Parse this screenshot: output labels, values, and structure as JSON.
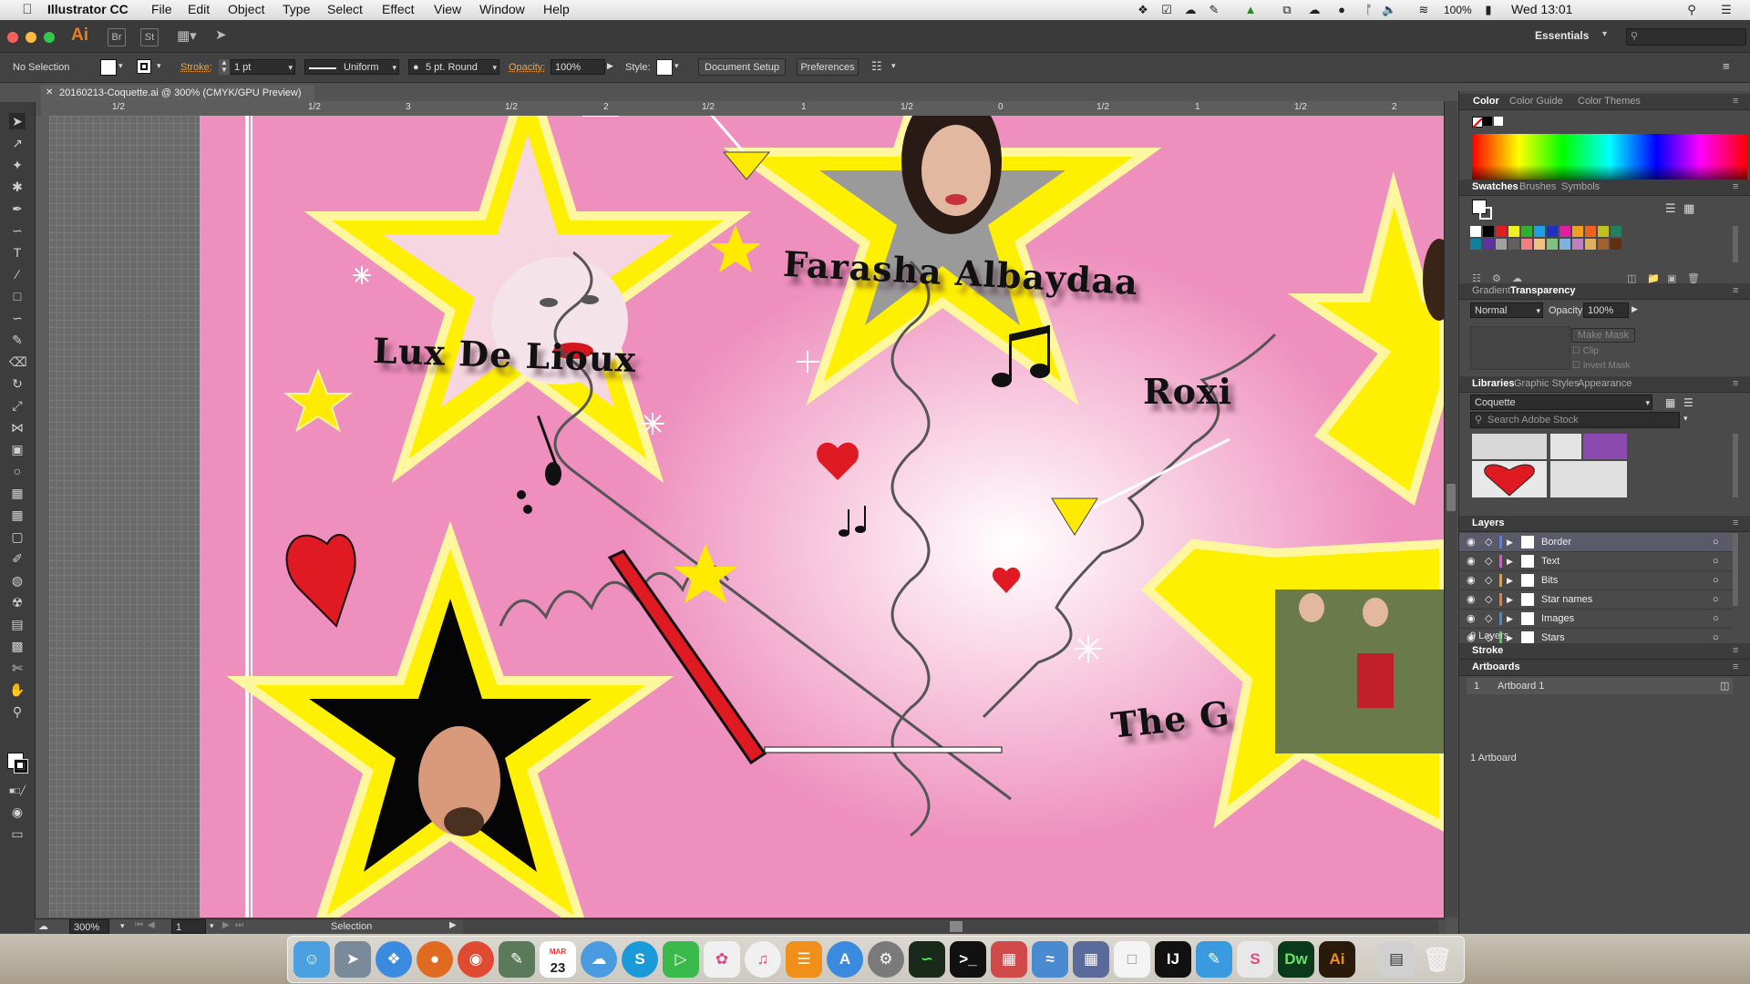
{
  "menubar": {
    "app_name": "Illustrator CC",
    "menus": [
      "File",
      "Edit",
      "Object",
      "Type",
      "Select",
      "Effect",
      "View",
      "Window",
      "Help"
    ],
    "battery": "100%",
    "clock": "Wed 13:01"
  },
  "appbar": {
    "logo": "Ai",
    "bridge": "Br",
    "stock": "St",
    "workspace": "Essentials"
  },
  "controlbar": {
    "selection": "No Selection",
    "stroke_label": "Stroke:",
    "stroke_value": "1 pt",
    "profile": "Uniform",
    "brush": "5 pt. Round",
    "opacity_label": "Opacity:",
    "opacity_value": "100%",
    "style_label": "Style:",
    "document_setup": "Document Setup",
    "preferences": "Preferences"
  },
  "document": {
    "tab_title": "20160213-Coquette.ai @ 300% (CMYK/GPU Preview)",
    "ruler_labels": [
      "1/2",
      "1/2",
      "3",
      "1/2",
      "2",
      "1/2",
      "1",
      "1/2",
      "0",
      "1/2",
      "1",
      "1/2",
      "2"
    ]
  },
  "artwork": {
    "performers": [
      "Lux De Lioux",
      "Farasha Albaydaa",
      "Roxi",
      "The G"
    ]
  },
  "status": {
    "zoom": "300%",
    "artboard_number": "1",
    "tool": "Selection"
  },
  "panels": {
    "color_tabs": [
      "Color",
      "Color Guide",
      "Color Themes"
    ],
    "swatch_tabs": [
      "Swatches",
      "Brushes",
      "Symbols"
    ],
    "gradient_tabs": [
      "Gradient",
      "Transparency"
    ],
    "blend_mode": "Normal",
    "opacity_label": "Opacity:",
    "opacity_value": "100%",
    "make_mask": "Make Mask",
    "clip": "Clip",
    "invert_mask": "Invert Mask",
    "library_tabs": [
      "Libraries",
      "Graphic Styles",
      "Appearance"
    ],
    "library_name": "Coquette",
    "stock_search_placeholder": "Search Adobe Stock",
    "layers_title": "Layers",
    "layers": [
      {
        "name": "Border",
        "color": "#4f7fff"
      },
      {
        "name": "Text",
        "color": "#e54ce0"
      },
      {
        "name": "Bits",
        "color": "#f0a020"
      },
      {
        "name": "Star names",
        "color": "#f07a30"
      },
      {
        "name": "Images",
        "color": "#4a8ad0"
      },
      {
        "name": "Stars",
        "color": "#4ad05a"
      }
    ],
    "layers_count": "9 Layers",
    "stroke_title": "Stroke",
    "artboards_title": "Artboards",
    "artboard_index": "1",
    "artboard_name": "Artboard 1",
    "artboards_count": "1 Artboard"
  },
  "dock": {
    "calendar_month": "MAR",
    "calendar_day": "23"
  }
}
